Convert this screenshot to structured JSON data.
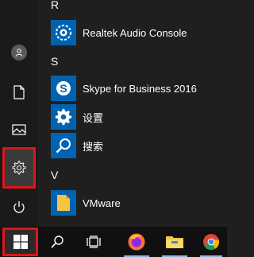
{
  "rail": {
    "items": [
      {
        "name": "user",
        "icon": "user-icon"
      },
      {
        "name": "documents",
        "icon": "document-icon"
      },
      {
        "name": "pictures",
        "icon": "picture-icon"
      },
      {
        "name": "settings",
        "icon": "gear-icon"
      },
      {
        "name": "power",
        "icon": "power-icon"
      }
    ]
  },
  "applist": {
    "groups": [
      {
        "letter": "R",
        "apps": [
          {
            "label": "Realtek Audio Console",
            "icon": "realtek-audio-icon"
          }
        ]
      },
      {
        "letter": "S",
        "apps": [
          {
            "label": "Skype for Business 2016",
            "icon": "skype-icon"
          },
          {
            "label": "设置",
            "icon": "gear-icon"
          },
          {
            "label": "搜索",
            "icon": "search-icon"
          }
        ]
      },
      {
        "letter": "V",
        "apps": [
          {
            "label": "VMware",
            "icon": "folder-icon"
          }
        ]
      }
    ]
  },
  "taskbar": {
    "items": [
      {
        "name": "start",
        "icon": "windows-logo-icon"
      },
      {
        "name": "search",
        "icon": "search-icon"
      },
      {
        "name": "task-view",
        "icon": "task-view-icon"
      },
      {
        "name": "firefox",
        "icon": "firefox-icon"
      },
      {
        "name": "file-explorer",
        "icon": "folder-icon"
      },
      {
        "name": "chrome",
        "icon": "chrome-icon"
      }
    ]
  },
  "colors": {
    "accent_tile": "#0063b1",
    "highlight_border": "#e0141b",
    "background": "#1f1f1f",
    "taskbar": "#101010"
  }
}
